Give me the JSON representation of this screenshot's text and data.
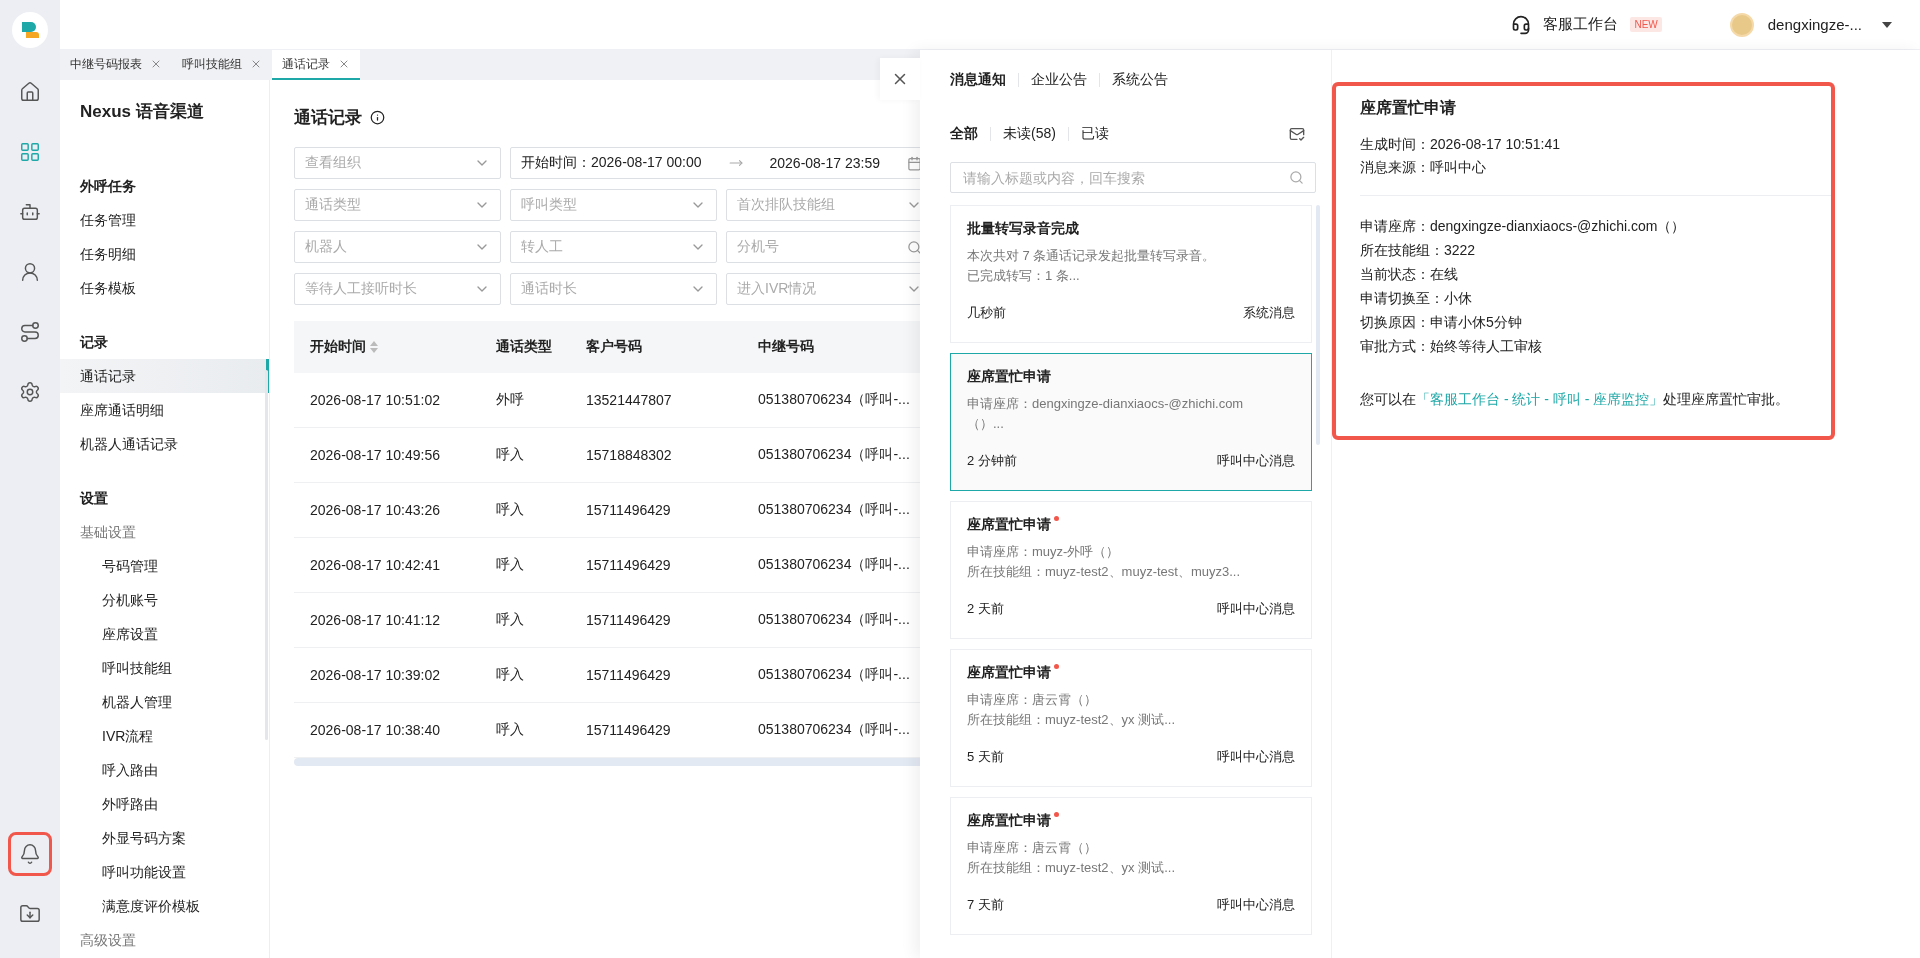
{
  "rail": {
    "items": [
      {
        "kind": "home",
        "selected": false,
        "highlighted": false
      },
      {
        "kind": "apps",
        "selected": true,
        "highlighted": false
      },
      {
        "kind": "robot",
        "selected": false,
        "highlighted": false
      },
      {
        "kind": "agent",
        "selected": false,
        "highlighted": false
      },
      {
        "kind": "route",
        "selected": false,
        "highlighted": false
      },
      {
        "kind": "settings",
        "selected": false,
        "highlighted": false
      }
    ],
    "bottom": [
      {
        "kind": "bell",
        "selected": false,
        "highlighted": true
      },
      {
        "kind": "download",
        "selected": false,
        "highlighted": false
      }
    ]
  },
  "top_bar": {
    "workbench": "客服工作台",
    "badge": "NEW",
    "user": "dengxingze-..."
  },
  "page_tabs": [
    {
      "label": "中继号码报表",
      "selected": false
    },
    {
      "label": "呼叫技能组",
      "selected": false
    },
    {
      "label": "通话记录",
      "selected": true
    }
  ],
  "nav": {
    "title": "Nexus 语音渠道",
    "sections": [
      {
        "heading": "外呼任务",
        "items": [
          {
            "kind": "link",
            "label": "任务管理",
            "selected": false
          },
          {
            "kind": "link",
            "label": "任务明细",
            "selected": false
          },
          {
            "kind": "link",
            "label": "任务模板",
            "selected": false
          }
        ]
      },
      {
        "heading": "记录",
        "items": [
          {
            "kind": "link",
            "label": "通话记录",
            "selected": true
          },
          {
            "kind": "link",
            "label": "座席通话明细",
            "selected": false
          },
          {
            "kind": "link",
            "label": "机器人通话记录",
            "selected": false
          }
        ]
      },
      {
        "heading": "设置",
        "items": [
          {
            "kind": "group",
            "label": "基础设置",
            "selected": false,
            "children": [
              {
                "label": "号码管理",
                "selected": false
              },
              {
                "label": "分机账号",
                "selected": false
              },
              {
                "label": "座席设置",
                "selected": false
              },
              {
                "label": "呼叫技能组",
                "selected": false
              },
              {
                "label": "机器人管理",
                "selected": false
              },
              {
                "label": "IVR流程",
                "selected": false
              },
              {
                "label": "呼入路由",
                "selected": false
              },
              {
                "label": "外呼路由",
                "selected": false
              },
              {
                "label": "外显号码方案",
                "selected": false
              },
              {
                "label": "呼叫功能设置",
                "selected": false
              },
              {
                "label": "满意度评价模板",
                "selected": false
              }
            ]
          },
          {
            "kind": "group",
            "label": "高级设置",
            "selected": false
          }
        ]
      }
    ]
  },
  "main": {
    "title": "通话记录",
    "filters": [
      {
        "kind": "select",
        "placeholder": "查看组织"
      },
      {
        "kind": "daterange",
        "label": "开始时间：",
        "start": "2026-08-17 00:00",
        "end": "2026-08-17 23:59"
      },
      {
        "kind": "select",
        "placeholder": "通话类型"
      },
      {
        "kind": "select",
        "placeholder": "呼叫类型"
      },
      {
        "kind": "select",
        "placeholder": "首次排队技能组"
      },
      {
        "kind": "select",
        "placeholder": "机器人"
      },
      {
        "kind": "select",
        "placeholder": "转人工"
      },
      {
        "kind": "search",
        "placeholder": "分机号"
      },
      {
        "kind": "select",
        "placeholder": "等待人工接听时长"
      },
      {
        "kind": "select",
        "placeholder": "通话时长"
      },
      {
        "kind": "select",
        "placeholder": "进入IVR情况"
      }
    ],
    "table": {
      "columns": [
        {
          "label": "开始时间",
          "sortable": true
        },
        {
          "label": "通话类型",
          "sortable": false
        },
        {
          "label": "客户号码",
          "sortable": false
        },
        {
          "label": "中继号码",
          "sortable": false
        }
      ],
      "rows": [
        [
          "2026-08-17 10:51:02",
          "外呼",
          "13521447807",
          "051380706234（呼叫-..."
        ],
        [
          "2026-08-17 10:49:56",
          "呼入",
          "15718848302",
          "051380706234（呼叫-..."
        ],
        [
          "2026-08-17 10:43:26",
          "呼入",
          "15711496429",
          "051380706234（呼叫-..."
        ],
        [
          "2026-08-17 10:42:41",
          "呼入",
          "15711496429",
          "051380706234（呼叫-..."
        ],
        [
          "2026-08-17 10:41:12",
          "呼入",
          "15711496429",
          "051380706234（呼叫-..."
        ],
        [
          "2026-08-17 10:39:02",
          "呼入",
          "15711496429",
          "051380706234（呼叫-..."
        ],
        [
          "2026-08-17 10:38:40",
          "呼入",
          "15711496429",
          "051380706234（呼叫-..."
        ]
      ]
    }
  },
  "drawer": {
    "tabs": [
      {
        "label": "消息通知",
        "selected": true
      },
      {
        "label": "企业公告",
        "selected": false
      },
      {
        "label": "系统公告",
        "selected": false
      }
    ],
    "filters": [
      {
        "label": "全部",
        "selected": true
      },
      {
        "label": "未读(58)",
        "selected": false
      },
      {
        "label": "已读",
        "selected": false
      }
    ],
    "search": {
      "placeholder": "请输入标题或内容，回车搜索"
    },
    "messages": [
      {
        "title": "批量转写录音完成",
        "lines": [
          "本次共对 7 条通话记录发起批量转写录音。",
          "已完成转写：1 条..."
        ],
        "time": "几秒前",
        "source": "系统消息",
        "unread": false,
        "selected": false
      },
      {
        "title": "座席置忙申请",
        "lines": [
          "申请座席：dengxingze-dianxiaocs-@zhichi.com",
          "（）..."
        ],
        "time": "2 分钟前",
        "source": "呼叫中心消息",
        "unread": false,
        "selected": true
      },
      {
        "title": "座席置忙申请",
        "lines": [
          "申请座席：muyz-外呼（）",
          "所在技能组：muyz-test2、muyz-test、muyz3..."
        ],
        "time": "2 天前",
        "source": "呼叫中心消息",
        "unread": true,
        "selected": false
      },
      {
        "title": "座席置忙申请",
        "lines": [
          "申请座席：唐云霄（）",
          "所在技能组：muyz-test2、yx 测试..."
        ],
        "time": "5 天前",
        "source": "呼叫中心消息",
        "unread": true,
        "selected": false
      },
      {
        "title": "座席置忙申请",
        "lines": [
          "申请座席：唐云霄（）",
          "所在技能组：muyz-test2、yx 测试..."
        ],
        "time": "7 天前",
        "source": "呼叫中心消息",
        "unread": true,
        "selected": false
      }
    ],
    "detail": {
      "title": "座席置忙申请",
      "highlighted": true,
      "meta": [
        "生成时间：2026-08-17 10:51:41",
        "消息来源：呼叫中心"
      ],
      "fields": [
        "申请座席：dengxingze-dianxiaocs-@zhichi.com（）",
        "所在技能组：3222",
        "当前状态：在线",
        "申请切换至：小休",
        "切换原因：申请小休5分钟",
        "审批方式：始终等待人工审核"
      ],
      "note": {
        "before": "您可以在",
        "link": "「客服工作台 - 统计 - 呼叫 - 座席监控」",
        "after": "处理座席置忙审批。"
      }
    }
  }
}
